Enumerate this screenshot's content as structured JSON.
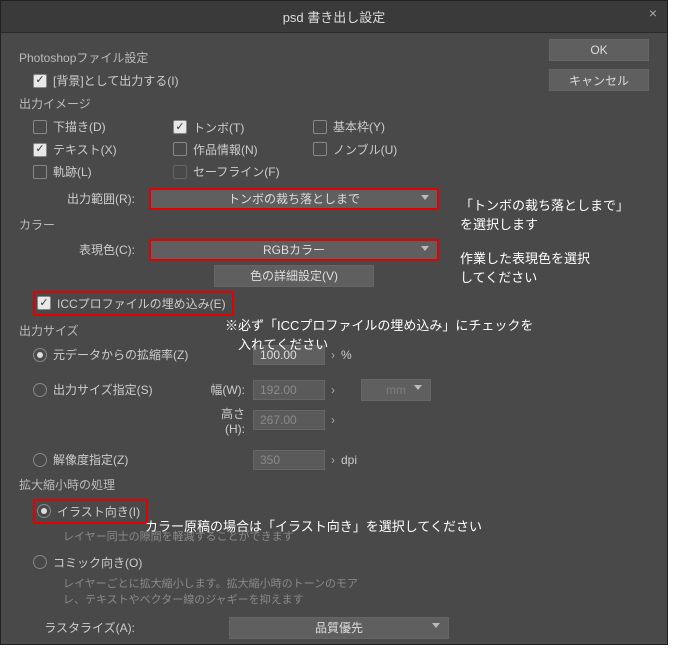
{
  "title": "psd 書き出し設定",
  "sections": {
    "psfile": "Photoshopファイル設定",
    "exportImage": "出力イメージ",
    "exportRange": "出力範囲(R):",
    "color": "カラー",
    "repColor": "表現色(C):",
    "size": "出力サイズ",
    "scaleProc": "拡大縮小時の処理",
    "raster": "ラスタライズ(A):"
  },
  "checkboxes": {
    "bgExport": "[背景]として出力する(I)",
    "draft": "下描き(D)",
    "text": "テキスト(X)",
    "track": "軌跡(L)",
    "tombo": "トンボ(T)",
    "work": "作品情報(N)",
    "safe": "セーフライン(F)",
    "base": "基本枠(Y)",
    "nombre": "ノンブル(U)",
    "icc": "ICCプロファイルの埋め込み(E)"
  },
  "dropdowns": {
    "range": "トンボの裁ち落としまで",
    "color": "RGBカラー",
    "unit": "mm",
    "raster": "品質優先"
  },
  "buttons": {
    "ok": "OK",
    "cancel": "キャンセル",
    "colorDetail": "色の詳細設定(V)"
  },
  "sizeFields": {
    "ratio": {
      "label": "元データからの拡縮率(Z)",
      "value": "100.00",
      "unit": "%"
    },
    "outSize": {
      "label": "出力サイズ指定(S)"
    },
    "width": {
      "label": "幅(W):",
      "value": "192.00"
    },
    "height": {
      "label": "高さ(H):",
      "value": "267.00"
    },
    "res": {
      "label": "解像度指定(Z)",
      "value": "350",
      "unit": "dpi"
    }
  },
  "radios": {
    "illust": {
      "label": "イラスト向き(I)",
      "caption": "レイヤー同士の隙間を軽減することができます"
    },
    "comic": {
      "label": "コミック向き(O)",
      "caption": "レイヤーごとに拡大縮小します。拡大縮小時のトーンのモアレ、テキストやベクター線のジャギーを抑えます"
    }
  },
  "annotations": {
    "range": "「トンボの裁ち落としまで」\nを選択します",
    "color": "作業した表現色を選択\nしてください",
    "icc": "※必ず「ICCプロファイルの埋め込み」にチェックを\n　入れてください",
    "illust": "カラー原稿の場合は「イラスト向き」を選択してください"
  }
}
